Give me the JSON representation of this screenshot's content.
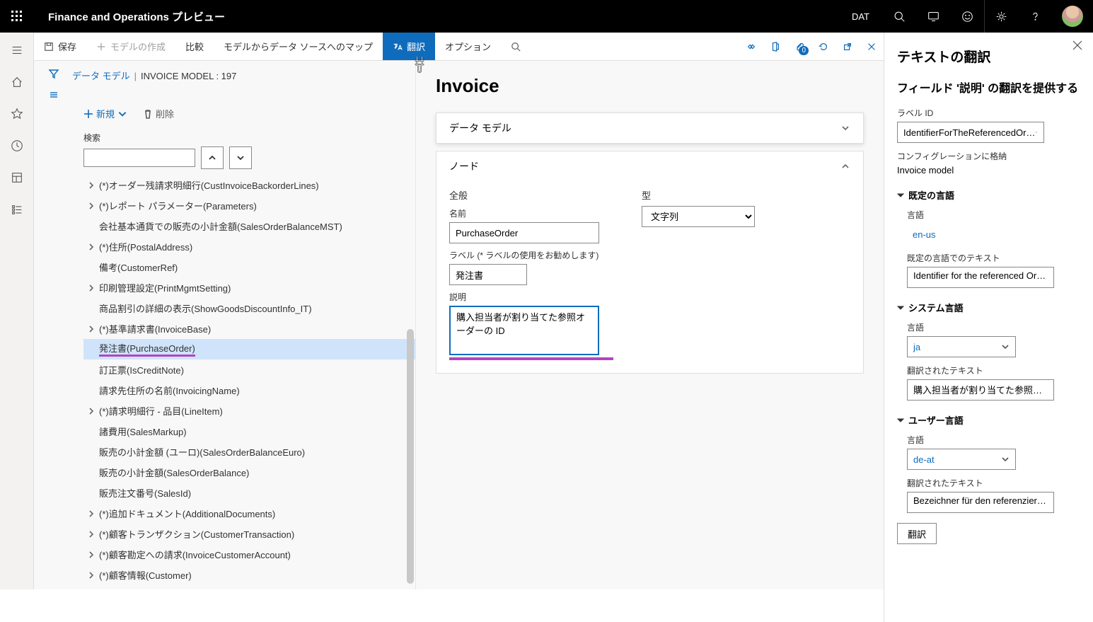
{
  "banner": {
    "title": "Finance and Operations プレビュー",
    "company": "DAT"
  },
  "toolbar": {
    "save": "保存",
    "new_model": "モデルの作成",
    "compare": "比較",
    "map_ds": "モデルからデータ ソースへのマップ",
    "translate": "翻訳",
    "options": "オプション",
    "badge_count": "0"
  },
  "breadcrumb": {
    "root": "データ モデル",
    "model": "INVOICE MODEL : 197"
  },
  "tree_actions": {
    "new": "新規",
    "delete": "削除"
  },
  "search": {
    "label": "検索",
    "value": ""
  },
  "tree_nodes": [
    {
      "expand": true,
      "label": "(*)オーダー残請求明細行(CustInvoiceBackorderLines)"
    },
    {
      "expand": true,
      "label": "(*)レポート パラメーター(Parameters)"
    },
    {
      "expand": false,
      "label": "会社基本通貨での販売の小計金額(SalesOrderBalanceMST)"
    },
    {
      "expand": true,
      "label": "(*)住所(PostalAddress)"
    },
    {
      "expand": false,
      "label": "備考(CustomerRef)"
    },
    {
      "expand": true,
      "label": "印刷管理設定(PrintMgmtSetting)"
    },
    {
      "expand": false,
      "label": "商品割引の詳細の表示(ShowGoodsDiscountInfo_IT)"
    },
    {
      "expand": true,
      "label": "(*)基準請求書(InvoiceBase)"
    },
    {
      "expand": false,
      "label": "発注書(PurchaseOrder)",
      "selected": true,
      "underline": true
    },
    {
      "expand": false,
      "label": "訂正票(IsCreditNote)"
    },
    {
      "expand": false,
      "label": "請求先住所の名前(InvoicingName)"
    },
    {
      "expand": true,
      "label": "(*)請求明細行 - 品目(LineItem)"
    },
    {
      "expand": false,
      "label": "諸費用(SalesMarkup)"
    },
    {
      "expand": false,
      "label": "販売の小計金額 (ユーロ)(SalesOrderBalanceEuro)"
    },
    {
      "expand": false,
      "label": "販売の小計金額(SalesOrderBalance)"
    },
    {
      "expand": false,
      "label": "販売注文番号(SalesId)"
    },
    {
      "expand": true,
      "label": "(*)追加ドキュメント(AdditionalDocuments)"
    },
    {
      "expand": true,
      "label": "(*)顧客トランザクション(CustomerTransaction)"
    },
    {
      "expand": true,
      "label": "(*)顧客勘定への請求(InvoiceCustomerAccount)"
    },
    {
      "expand": true,
      "label": "(*)顧客情報(Customer)"
    }
  ],
  "detail": {
    "heading": "Invoice",
    "panel_datamodel": "データ モデル",
    "panel_node": "ノード",
    "section_general": "全般",
    "section_type": "型",
    "name_label": "名前",
    "name_value": "PurchaseOrder",
    "label_label": "ラベル (* ラベルの使用をお勧めします)",
    "label_value": "発注書",
    "desc_label": "説明",
    "desc_value": "購入担当者が割り当てた参照オーダーの ID",
    "type_value": "文字列"
  },
  "flyout": {
    "title": "テキストの翻訳",
    "subtitle": "フィールド '説明' の翻訳を提供する",
    "labelid_label": "ラベル ID",
    "labelid_value": "IdentifierForTheReferencedOr…",
    "storedin_label": "コンフィグレーションに格納",
    "storedin_value": "Invoice model",
    "g_default": "既定の言語",
    "lang_label": "言語",
    "default_lang": "en-us",
    "default_text_label": "既定の言語でのテキスト",
    "default_text_value": "Identifier for the referenced Or…",
    "g_system": "システム言語",
    "system_lang": "ja",
    "translated_text_label": "翻訳されたテキスト",
    "system_text_value": "購入担当者が割り当てた参照オ…",
    "g_user": "ユーザー言語",
    "user_lang": "de-at",
    "user_text_value": "Bezeichner für den referenzierte…",
    "translate_button": "翻訳"
  }
}
